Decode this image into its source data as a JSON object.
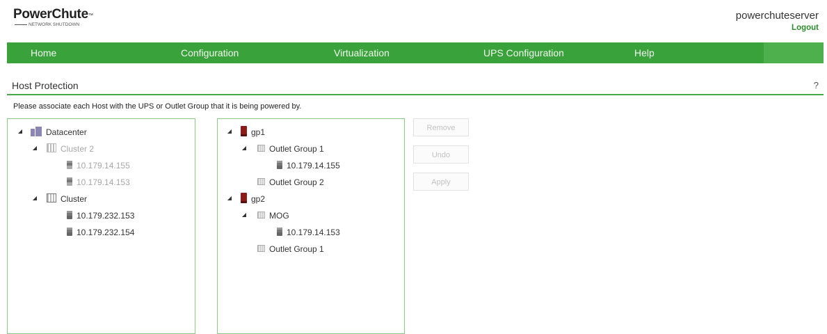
{
  "brand": {
    "name": "PowerChute",
    "tm": "™",
    "tagline": "NETWORK SHUTDOWN"
  },
  "user": {
    "name": "powerchuteserver",
    "logout_label": "Logout"
  },
  "nav": {
    "items": [
      {
        "label": "Home"
      },
      {
        "label": "Configuration"
      },
      {
        "label": "Virtualization"
      },
      {
        "label": "UPS Configuration"
      },
      {
        "label": "Help"
      }
    ]
  },
  "page": {
    "title": "Host Protection",
    "help_label": "?",
    "instruction": "Please associate each Host with the UPS or Outlet Group that it is being powered by."
  },
  "left_tree": {
    "datacenter": {
      "label": "Datacenter",
      "icon": "datacenter-icon"
    },
    "cluster2": {
      "label": "Cluster 2",
      "icon": "cluster-icon"
    },
    "host1": {
      "label": "10.179.14.155",
      "icon": "server-icon"
    },
    "host2": {
      "label": "10.179.14.153",
      "icon": "server-icon"
    },
    "cluster": {
      "label": "Cluster",
      "icon": "cluster-icon"
    },
    "host3": {
      "label": "10.179.232.153",
      "icon": "server-icon"
    },
    "host4": {
      "label": "10.179.232.154",
      "icon": "server-icon"
    }
  },
  "right_tree": {
    "ups1": {
      "label": "gp1",
      "icon": "ups-icon"
    },
    "og1": {
      "label": "Outlet Group 1",
      "icon": "outlet-group-icon"
    },
    "host1": {
      "label": "10.179.14.155",
      "icon": "server-icon"
    },
    "og2": {
      "label": "Outlet Group 2",
      "icon": "outlet-group-icon"
    },
    "ups2": {
      "label": "gp2",
      "icon": "ups-icon"
    },
    "mog": {
      "label": "MOG",
      "icon": "outlet-group-icon"
    },
    "host2": {
      "label": "10.179.14.153",
      "icon": "server-icon"
    },
    "og3": {
      "label": "Outlet Group 1",
      "icon": "outlet-group-icon"
    }
  },
  "actions": {
    "remove_label": "Remove",
    "undo_label": "Undo",
    "apply_label": "Apply"
  },
  "colors": {
    "nav_green": "#3aa23a",
    "accent_green": "#2e8b2e",
    "panel_border": "#8bc98b",
    "ups_red": "#8a1c1c"
  }
}
